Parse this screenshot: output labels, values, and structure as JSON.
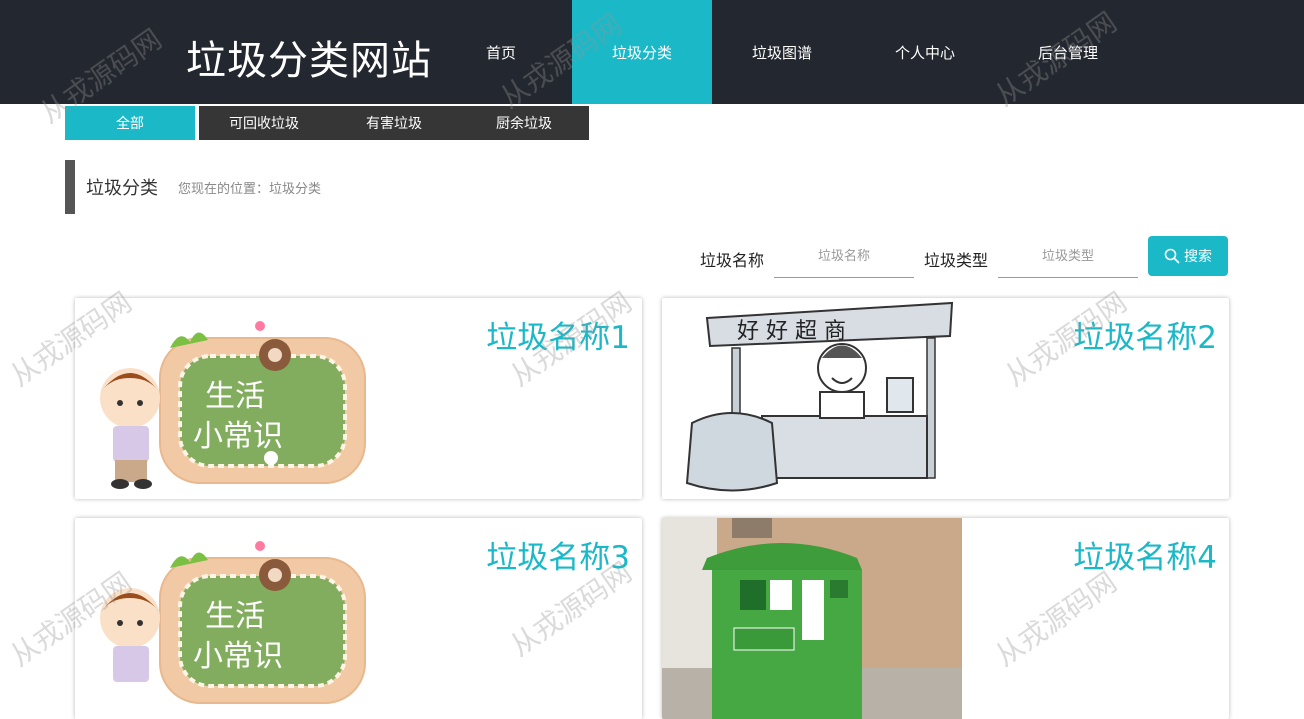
{
  "header": {
    "site_title": "垃圾分类网站",
    "nav": [
      {
        "label": "首页",
        "active": false
      },
      {
        "label": "垃圾分类",
        "active": true
      },
      {
        "label": "垃圾图谱",
        "active": false
      },
      {
        "label": "个人中心",
        "active": false
      },
      {
        "label": "后台管理",
        "active": false
      }
    ]
  },
  "subtabs": [
    {
      "label": "全部",
      "active": true
    },
    {
      "label": "可回收垃圾",
      "active": false
    },
    {
      "label": "有害垃圾",
      "active": false
    },
    {
      "label": "厨余垃圾",
      "active": false
    }
  ],
  "breadcrumb": {
    "title": "垃圾分类",
    "location": "您现在的位置：垃圾分类"
  },
  "search": {
    "name_label": "垃圾名称",
    "name_placeholder": "垃圾名称",
    "type_label": "垃圾类型",
    "type_placeholder": "垃圾类型",
    "button_label": "搜索"
  },
  "cards": [
    {
      "title": "垃圾名称1",
      "image": "life-tips-cartoon"
    },
    {
      "title": "垃圾名称2",
      "image": "shop-stall-sketch"
    },
    {
      "title": "垃圾名称3",
      "image": "life-tips-cartoon"
    },
    {
      "title": "垃圾名称4",
      "image": "green-recycling-bin"
    }
  ],
  "watermark": "从戎源码网",
  "colors": {
    "accent": "#1bb8c8",
    "header_bg": "#23272f",
    "subtab_bg": "#363636"
  }
}
